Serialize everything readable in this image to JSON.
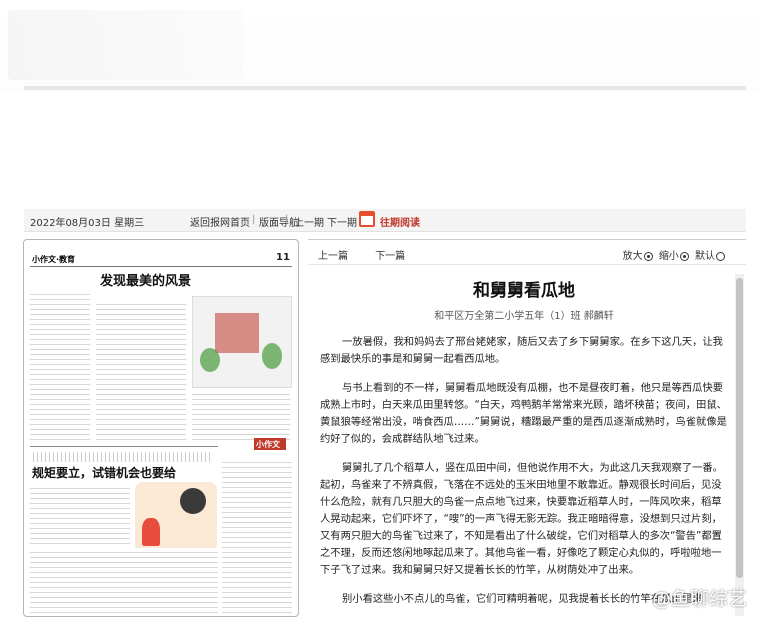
{
  "datebar": {
    "date": "2022年08月03日 星期三",
    "home_link": "返回报网首页",
    "layout_nav": "版面导航",
    "prev_page": "上一期",
    "next_page": "下一期",
    "past_issues": "往期阅读"
  },
  "newspaper_page": {
    "section": "小作文·教育",
    "page_number": "11",
    "headline_top": "发现最美的风景",
    "headline_bottom": "规矩要立，试错机会也要给",
    "stamp": "小作文"
  },
  "reader": {
    "prev_article": "上一篇",
    "next_article": "下一篇",
    "zoom_in": "放大",
    "zoom_out": "缩小",
    "zoom_default": "默认"
  },
  "article": {
    "title": "和舅舅看瓜地",
    "author": "和平区万全第二小学五年（1）班 郝麟轩",
    "paragraphs": [
      "一放暑假，我和妈妈去了邢台姥姥家，随后又去了乡下舅舅家。在乡下这几天，让我感到最快乐的事是和舅舅一起看西瓜地。",
      "与书上看到的不一样，舅舅看瓜地既没有瓜棚，也不是昼夜盯着，他只是等西瓜快要成熟上市时，白天来瓜田里转悠。“白天，鸡鸭鹅羊常常来光顾，踏坏秧苗；夜间，田鼠、黄鼠狼等经常出没，啃食西瓜……”舅舅说，糟蹋最严重的是西瓜逐渐成熟时，鸟雀就像是约好了似的，会成群结队地飞过来。",
      "舅舅扎了几个稻草人，竖在瓜田中间，但他说作用不大，为此这几天我观察了一番。起初，鸟雀来了不辨真假，飞落在不远处的玉米田地里不敢靠近。静观很长时间后，见没什么危险，就有几只胆大的鸟雀一点点地飞过来，快要靠近稻草人时，一阵风吹来，稻草人晃动起来，它们吓坏了，“嗖”的一声飞得无影无踪。我正暗暗得意，没想到只过片刻，又有两只胆大的鸟雀飞过来了，不知是看出了什么破绽，它们对稻草人的多次“警告”都置之不理，反而还悠闲地啄起瓜来了。其他鸟雀一看，好像吃了颗定心丸似的，呼啦啦地一下子飞了过来。我和舅舅只好又提着长长的竹竿，从树荫处冲了出来。",
      "别小看这些小不点儿的鸟雀，它们可精明着呢，见我提着长长的竹竿在瓜田里来"
    ]
  },
  "watermark": "@鱼聊综艺"
}
